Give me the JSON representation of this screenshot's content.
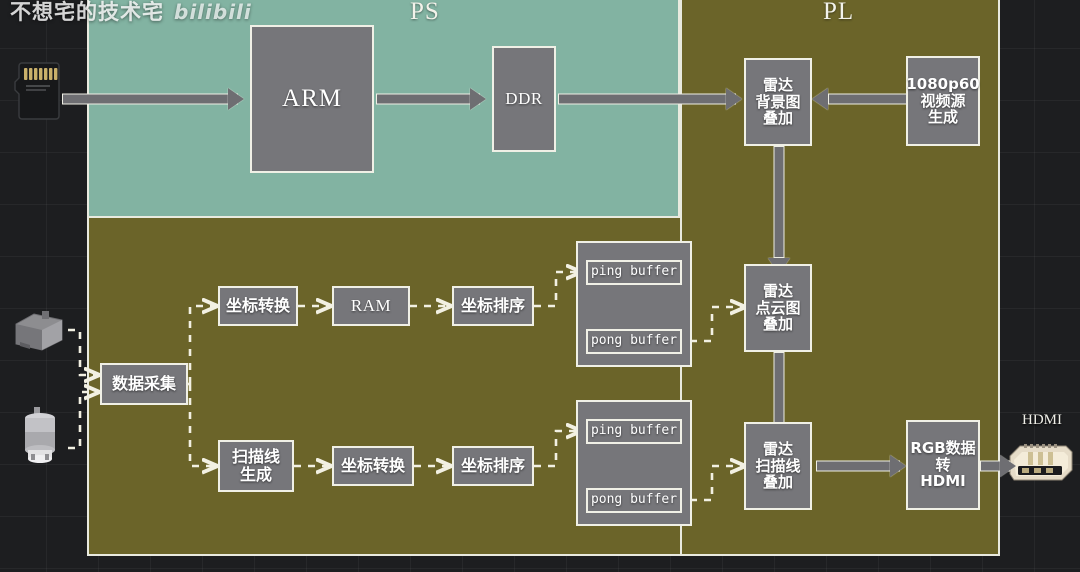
{
  "watermark": {
    "author": "不想宅的技术宅",
    "site": "bilibili"
  },
  "regions": {
    "ps": {
      "label": "PS",
      "color": "#82b3a2"
    },
    "pl": {
      "label": "PL",
      "color": "#6b6429"
    }
  },
  "peripherals": {
    "sdcard": {
      "name": "micro-sd-card"
    },
    "lidar": {
      "name": "lidar-sensor"
    },
    "motor": {
      "name": "motor"
    },
    "hdmi": {
      "name": "hdmi-connector",
      "label": "HDMI"
    }
  },
  "blocks": {
    "arm": "ARM",
    "ddr": "DDR",
    "radar_background_overlay": "雷达\n背景图\n叠加",
    "video_source": "1080p60\n视频源\n生成",
    "coord_convert_1": "坐标转换",
    "ram": "RAM",
    "coord_sort_1": "坐标排序",
    "ping_buffer_1": "ping buffer",
    "pong_buffer_1": "pong buffer",
    "radar_pointcloud_overlay": "雷达\n点云图\n叠加",
    "data_acquisition": "数据采集",
    "scanline_generate": "扫描线\n生成",
    "coord_convert_2": "坐标转换",
    "coord_sort_2": "坐标排序",
    "ping_buffer_2": "ping buffer",
    "pong_buffer_2": "pong buffer",
    "radar_scanline_overlay": "雷达\n扫描线\n叠加",
    "rgb_to_hdmi": "RGB数据\n转\nHDMI"
  },
  "diagram": {
    "type": "block-diagram",
    "title": "雷达显示系统 PS/PL 框图",
    "flows": [
      {
        "from": "sdcard",
        "to": "arm",
        "style": "solid"
      },
      {
        "from": "arm",
        "to": "ddr",
        "style": "solid"
      },
      {
        "from": "ddr",
        "to": "radar_background_overlay",
        "style": "solid"
      },
      {
        "from": "video_source",
        "to": "radar_background_overlay",
        "style": "solid"
      },
      {
        "from": "radar_background_overlay",
        "to": "radar_pointcloud_overlay",
        "style": "solid"
      },
      {
        "from": "radar_pointcloud_overlay",
        "to": "radar_scanline_overlay",
        "style": "solid"
      },
      {
        "from": "radar_scanline_overlay",
        "to": "rgb_to_hdmi",
        "style": "solid"
      },
      {
        "from": "rgb_to_hdmi",
        "to": "hdmi",
        "style": "solid"
      },
      {
        "from": "lidar",
        "to": "data_acquisition",
        "style": "dashed"
      },
      {
        "from": "motor",
        "to": "data_acquisition",
        "style": "dashed"
      },
      {
        "from": "data_acquisition",
        "to": "coord_convert_1",
        "style": "dashed"
      },
      {
        "from": "data_acquisition",
        "to": "scanline_generate",
        "style": "dashed"
      },
      {
        "from": "coord_convert_1",
        "to": "ram",
        "style": "dashed"
      },
      {
        "from": "ram",
        "to": "coord_sort_1",
        "style": "dashed"
      },
      {
        "from": "coord_sort_1",
        "to": "ping_buffer_1",
        "style": "dashed"
      },
      {
        "from": "pong_buffer_1",
        "to": "radar_pointcloud_overlay",
        "style": "dashed"
      },
      {
        "from": "scanline_generate",
        "to": "coord_convert_2",
        "style": "dashed"
      },
      {
        "from": "coord_convert_2",
        "to": "coord_sort_2",
        "style": "dashed"
      },
      {
        "from": "coord_sort_2",
        "to": "ping_buffer_2",
        "style": "dashed"
      },
      {
        "from": "pong_buffer_2",
        "to": "radar_scanline_overlay",
        "style": "dashed"
      }
    ]
  }
}
